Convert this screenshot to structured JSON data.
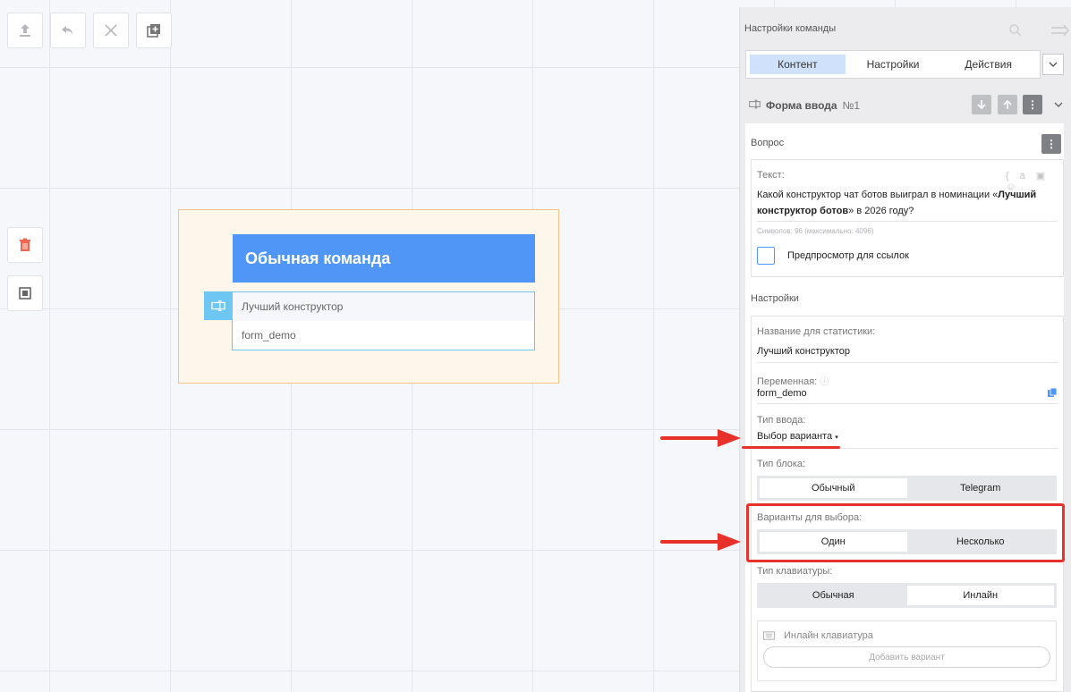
{
  "toolbar": {
    "icons": [
      "upload-icon",
      "undo-icon",
      "close-icon",
      "add-copy-icon"
    ],
    "side_icons": [
      "trash-icon",
      "fit-screen-icon"
    ]
  },
  "command": {
    "title": "Обычная команда",
    "block_text": "Лучший конструктор",
    "variable": "form_demo"
  },
  "panel": {
    "header": "Настройки команды",
    "tabs": [
      "Контент",
      "Настройки",
      "Действия"
    ],
    "active_tab": "Контент",
    "section": {
      "title": "Форма ввода",
      "number": "№1"
    },
    "question_label": "Вопрос",
    "text_label": "Текст:",
    "text_part1": "Какой конструктор чат ботов выиграл в номинации «",
    "text_bold": "Лучший конструктор ботов",
    "text_part2": "» в 2026 году?",
    "symbols": "Символов: 96 (максимально: 4096)",
    "preview_label": "Предпросмотр для ссылок",
    "settings_label": "Настройки",
    "stat_name_label": "Название для статистики:",
    "stat_name_value": "Лучший конструктор",
    "variable_label": "Переменная:",
    "variable_value": "form_demo",
    "input_type_label": "Тип ввода:",
    "input_type_value": "Выбор варианта",
    "block_type_label": "Тип блока:",
    "block_type_options": [
      "Обычный",
      "Telegram"
    ],
    "block_type_selected": "Обычный",
    "choice_label": "Варианты для выбора:",
    "choice_options": [
      "Один",
      "Несколько"
    ],
    "choice_selected": "Один",
    "keyboard_label": "Тип клавиатуры:",
    "keyboard_options": [
      "Обычная",
      "Инлайн"
    ],
    "keyboard_selected": "Инлайн",
    "inline_kb_label": "Инлайн клавиатура",
    "add_variant": "Добавить вариант"
  },
  "colors": {
    "accent_blue": "#5096f7",
    "highlight_red": "#e8312a",
    "tab_active": "#cfe1fb"
  }
}
